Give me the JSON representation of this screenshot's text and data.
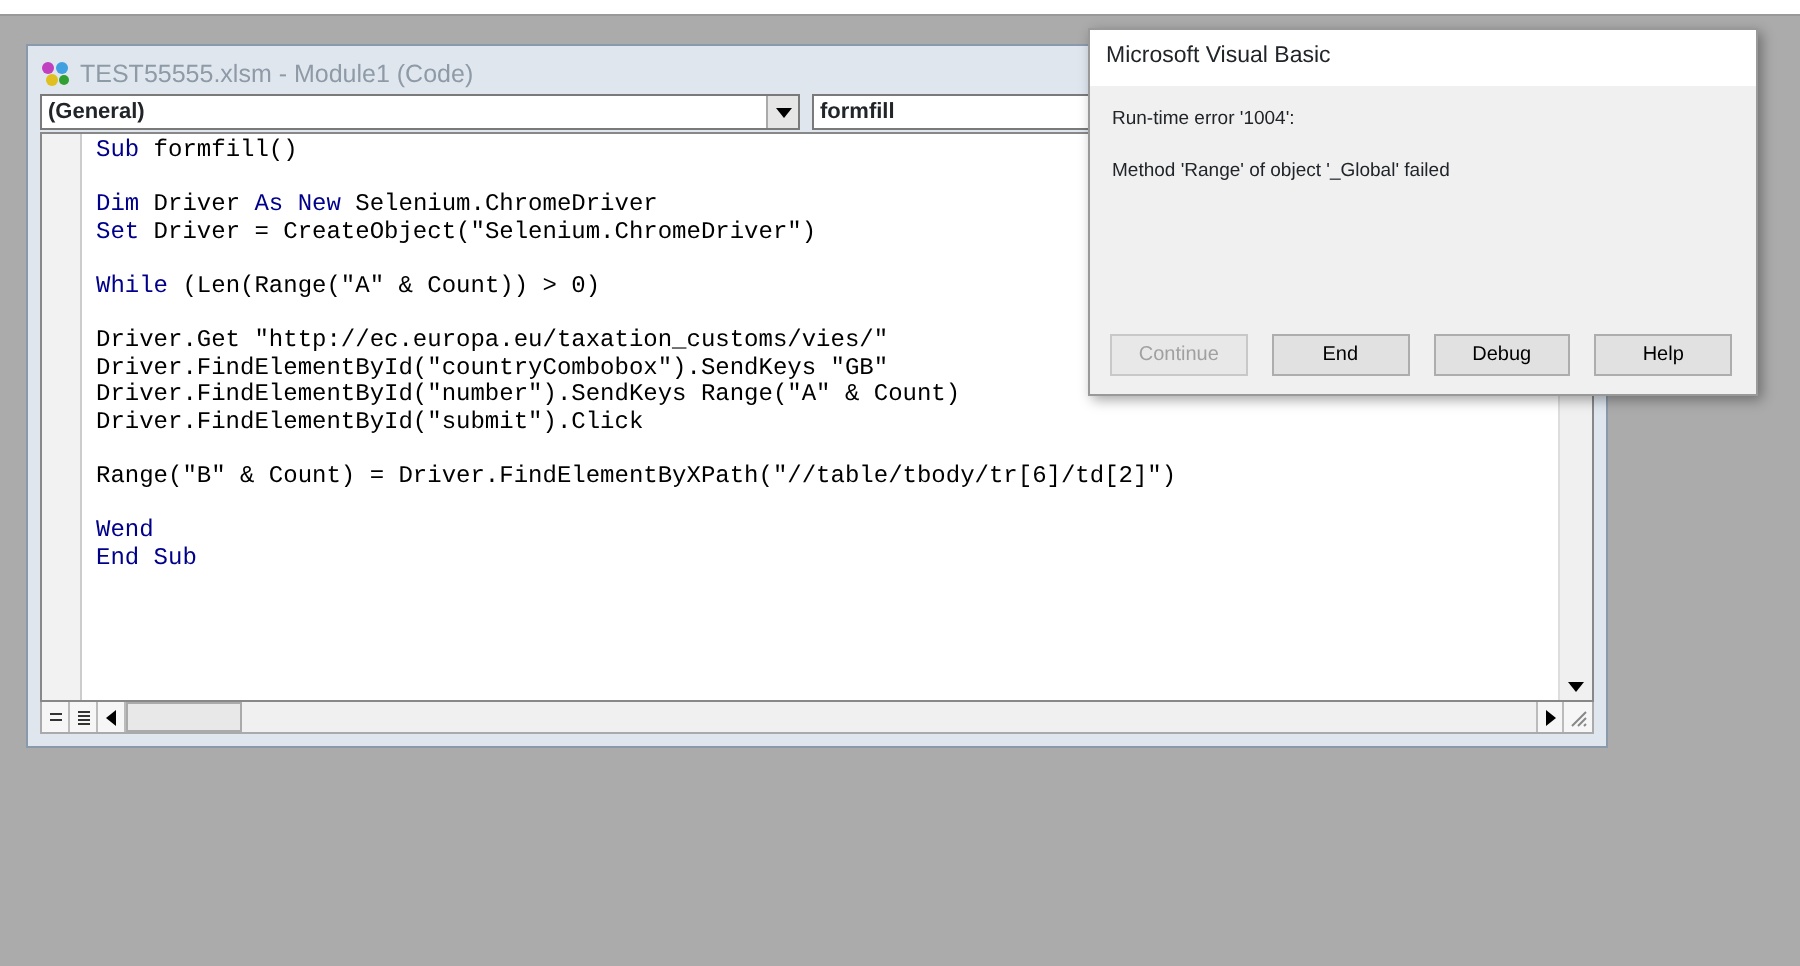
{
  "editor": {
    "title": "TEST55555.xlsm - Module1 (Code)",
    "object_dropdown": "(General)",
    "procedure_dropdown": "formfill",
    "lines": [
      {
        "kind": "code",
        "tokens": [
          {
            "kind": "keyword",
            "text": "Sub"
          },
          {
            "kind": "plain",
            "text": " formfill()"
          }
        ]
      },
      {
        "kind": "blank"
      },
      {
        "kind": "code",
        "tokens": [
          {
            "kind": "keyword",
            "text": "Dim"
          },
          {
            "kind": "plain",
            "text": " Driver "
          },
          {
            "kind": "keyword",
            "text": "As New"
          },
          {
            "kind": "plain",
            "text": " Selenium.ChromeDriver"
          }
        ]
      },
      {
        "kind": "code",
        "tokens": [
          {
            "kind": "keyword",
            "text": "Set"
          },
          {
            "kind": "plain",
            "text": " Driver = CreateObject(\"Selenium.ChromeDriver\")"
          }
        ]
      },
      {
        "kind": "blank"
      },
      {
        "kind": "code",
        "tokens": [
          {
            "kind": "keyword",
            "text": "While"
          },
          {
            "kind": "plain",
            "text": " (Len(Range(\"A\" & Count)) > 0)"
          }
        ]
      },
      {
        "kind": "blank"
      },
      {
        "kind": "code",
        "tokens": [
          {
            "kind": "plain",
            "text": "Driver.Get \"http://ec.europa.eu/taxation_customs/vies/\""
          }
        ]
      },
      {
        "kind": "code",
        "tokens": [
          {
            "kind": "plain",
            "text": "Driver.FindElementById(\"countryCombobox\").SendKeys \"GB\""
          }
        ]
      },
      {
        "kind": "code",
        "tokens": [
          {
            "kind": "plain",
            "text": "Driver.FindElementById(\"number\").SendKeys Range(\"A\" & Count)"
          }
        ]
      },
      {
        "kind": "code",
        "tokens": [
          {
            "kind": "plain",
            "text": "Driver.FindElementById(\"submit\").Click"
          }
        ]
      },
      {
        "kind": "blank"
      },
      {
        "kind": "code",
        "tokens": [
          {
            "kind": "plain",
            "text": "Range(\"B\" & Count) = Driver.FindElementByXPath(\"//table/tbody/tr[6]/td[2]\")"
          }
        ]
      },
      {
        "kind": "blank"
      },
      {
        "kind": "code",
        "tokens": [
          {
            "kind": "keyword",
            "text": "Wend"
          }
        ]
      },
      {
        "kind": "code",
        "tokens": [
          {
            "kind": "keyword",
            "text": "End Sub"
          }
        ]
      }
    ]
  },
  "dialog": {
    "title": "Microsoft Visual Basic",
    "error": "Run-time error '1004':",
    "message": "Method 'Range' of object '_Global' failed",
    "buttons": [
      {
        "label": "Continue",
        "disabled": true
      },
      {
        "label": "End",
        "disabled": false
      },
      {
        "label": "Debug",
        "disabled": false
      },
      {
        "label": "Help",
        "disabled": false
      }
    ]
  }
}
